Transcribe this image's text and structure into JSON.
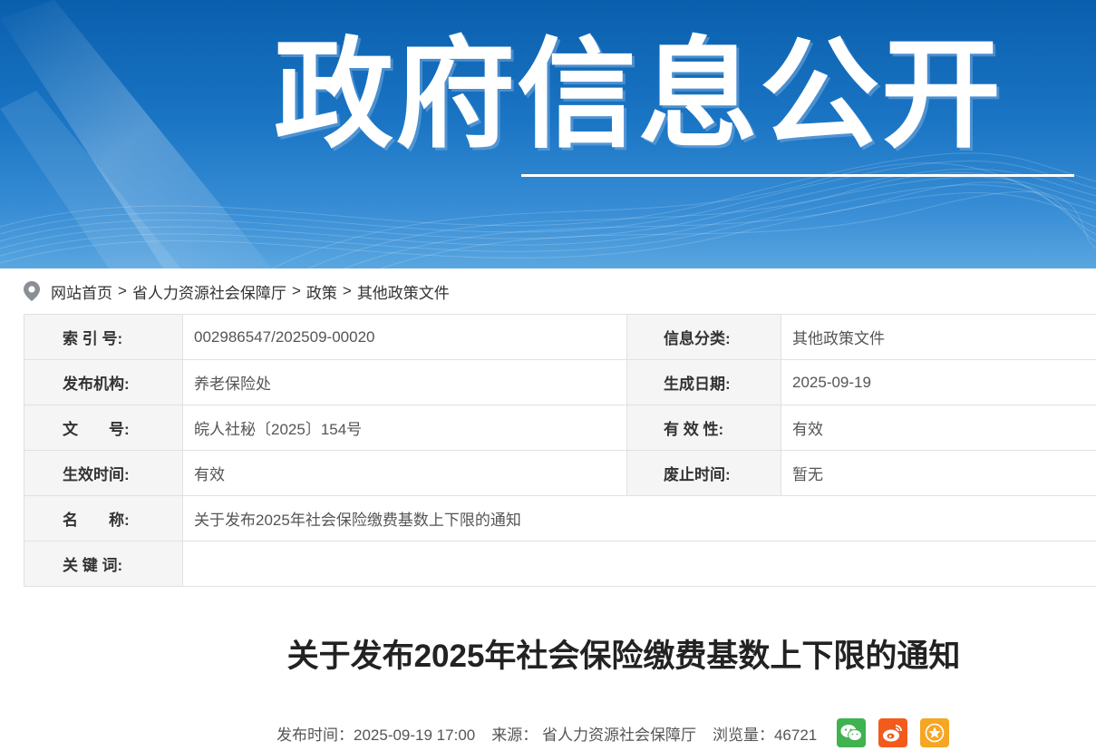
{
  "banner": {
    "title": "政府信息公开"
  },
  "breadcrumb": {
    "items": [
      "网站首页",
      "省人力资源社会保障厅",
      "政策",
      "其他政策文件"
    ],
    "separator": ">"
  },
  "meta": {
    "index_label": "索 引 号:",
    "index_value": "002986547/202509-00020",
    "category_label": "信息分类:",
    "category_value": "其他政策文件",
    "publisher_label": "发布机构:",
    "publisher_value": "养老保险处",
    "date_label": "生成日期:",
    "date_value": "2025-09-19",
    "docno_label": "文　　号:",
    "docno_value": "皖人社秘〔2025〕154号",
    "validity_label": "有 效 性:",
    "validity_value": "有效",
    "effective_label": "生效时间:",
    "effective_value": "有效",
    "expiry_label": "废止时间:",
    "expiry_value": "暂无",
    "name_label": "名　　称:",
    "name_value": "关于发布2025年社会保险缴费基数上下限的通知",
    "keywords_label": "关 键 词:",
    "keywords_value": ""
  },
  "article": {
    "title": "关于发布2025年社会保险缴费基数上下限的通知",
    "publish_time": "发布时间：2025-09-19 17:00",
    "source": "来源：  省人力资源社会保障厅",
    "views": "浏览量：46721"
  },
  "share": {
    "icons": [
      "wechat-icon",
      "weibo-icon",
      "favorite-icon"
    ],
    "colors": {
      "wechat": "#3fb34f",
      "weibo": "#f25b1c",
      "favorite": "#f5a623"
    }
  },
  "colors": {
    "banner_blue": "#0a5fad",
    "label_bg": "#f5f5f5",
    "border": "#e1e1e1"
  }
}
